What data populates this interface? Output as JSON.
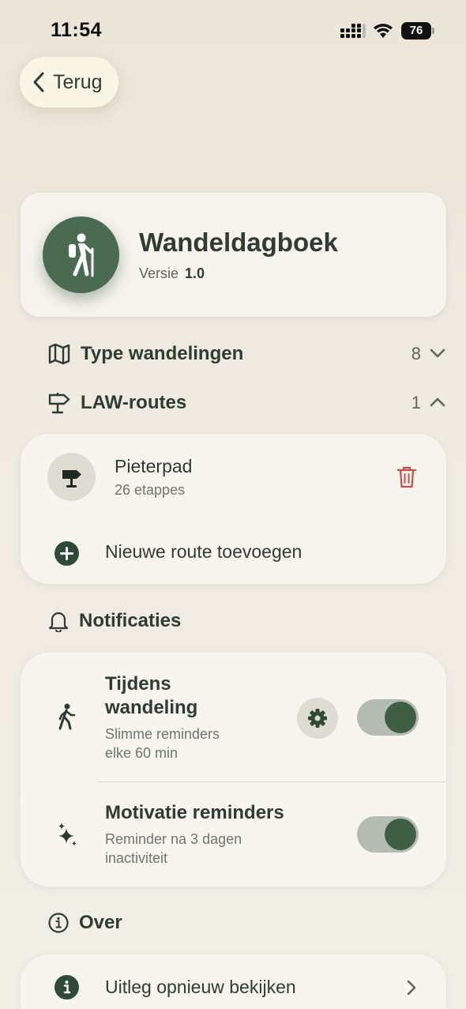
{
  "status_bar": {
    "time": "11:54",
    "battery": "76"
  },
  "nav": {
    "back_label": "Terug"
  },
  "app": {
    "name": "Wandeldagboek",
    "version_label": "Versie",
    "version": "1.0"
  },
  "sections": {
    "types": {
      "label": "Type wandelingen",
      "count": "8",
      "expanded": false
    },
    "law_routes": {
      "label": "LAW-routes",
      "count": "1",
      "expanded": true
    },
    "notifications": {
      "label": "Notificaties"
    },
    "about": {
      "label": "Over"
    }
  },
  "routes": [
    {
      "name": "Pieterpad",
      "subtitle": "26 etappes"
    }
  ],
  "add_route_label": "Nieuwe route toevoegen",
  "notifications": {
    "during_walk": {
      "title_line1": "Tijdens",
      "title_line2": "wandeling",
      "sub_line1": "Slimme reminders",
      "sub_line2": "elke 60 min",
      "enabled": true
    },
    "motivation": {
      "title": "Motivatie reminders",
      "sub_line1": "Reminder na 3 dagen",
      "sub_line2": "inactiviteit",
      "enabled": true
    }
  },
  "about_items": [
    {
      "label": "Uitleg opnieuw bekijken"
    }
  ],
  "colors": {
    "accent": "#3e5f46",
    "logo_bg": "#4a6b52",
    "delete": "#c0504d",
    "background": "#ece7db",
    "card": "#f7f5ee"
  }
}
